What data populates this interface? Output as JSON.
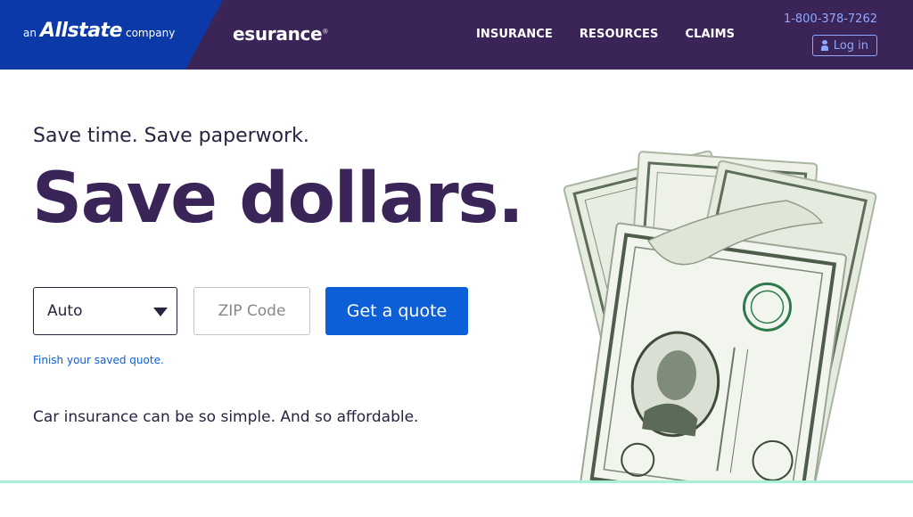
{
  "header": {
    "allstate": {
      "prefix": "an",
      "brand": "Allstate",
      "suffix": "company"
    },
    "esurance_brand": "esurance",
    "nav": [
      {
        "label": "INSURANCE"
      },
      {
        "label": "RESOURCES"
      },
      {
        "label": "CLAIMS"
      }
    ],
    "phone": "1-800-378-7262",
    "login_label": "Log in"
  },
  "hero": {
    "tagline": "Save time. Save paperwork.",
    "headline": "Save dollars.",
    "product_select": {
      "value": "Auto"
    },
    "zip": {
      "placeholder": "ZIP Code",
      "value": ""
    },
    "quote_button": "Get a quote",
    "saved_quote_link": "Finish your saved quote.",
    "subtext": "Car insurance can be so simple. And so affordable."
  },
  "colors": {
    "header_bg": "#3a2458",
    "allstate_blue": "#0b3aa8",
    "accent_blue": "#0d5fd8",
    "headline_purple": "#3a2458",
    "link_blue": "#8fa8ff",
    "bottom_rule": "#a8f0d8"
  },
  "icons": {
    "dropdown": "caret-down-icon",
    "login": "user-icon"
  }
}
